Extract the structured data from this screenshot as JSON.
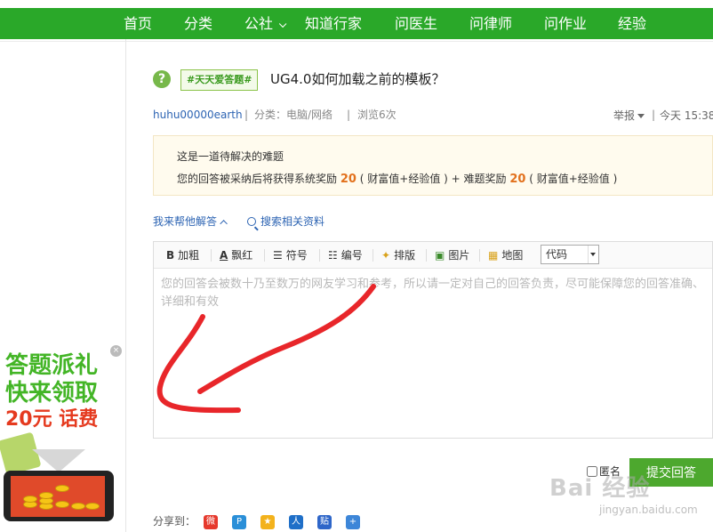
{
  "nav": {
    "items": [
      "首页",
      "分类",
      "公社",
      "知道行家",
      "问医生",
      "问律师",
      "问作业",
      "经验"
    ]
  },
  "question": {
    "tag": "#天天爱答题#",
    "title": "UG4.0如何加载之前的模板？",
    "user": "huhu00000earth",
    "category": "分类：电脑/网络",
    "views": "浏览6次",
    "report": "举报",
    "time": "今天 15:38"
  },
  "notice": {
    "line1": "这是一道待解决的难题",
    "line2_a": "您的回答被采纳后将获得系统奖励",
    "reward1": "20",
    "line2_b": "( 财富值+经验值 ) + 难题奖励",
    "reward2": "20",
    "line2_c": "( 财富值+经验值 )"
  },
  "help": {
    "answer_link": "我来帮他解答",
    "search_link": "搜索相关资料"
  },
  "toolbar": {
    "bold": "加粗",
    "red": "飘红",
    "symbol": "符号",
    "numbering": "编号",
    "layout": "排版",
    "image": "图片",
    "map": "地图",
    "code_select": "代码"
  },
  "editor": {
    "placeholder": "您的回答会被数十乃至数万的网友学习和参考，所以请一定对自己的回答负责，尽可能保障您的回答准确、详细和有效"
  },
  "footer": {
    "anonymous": "匿名",
    "submit": "提交回答",
    "share": "分享到："
  },
  "ad": {
    "line1": "答题派礼",
    "line2": "快来领取",
    "line3": "20元 话费"
  },
  "watermark": {
    "logo": "Bai 经验",
    "url": "jingyan.baidu.com"
  },
  "colors": {
    "nav_bg": "#2aa829",
    "accent_orange": "#e2711d",
    "link_blue": "#2d64b3",
    "submit_bg": "#4da82e"
  }
}
